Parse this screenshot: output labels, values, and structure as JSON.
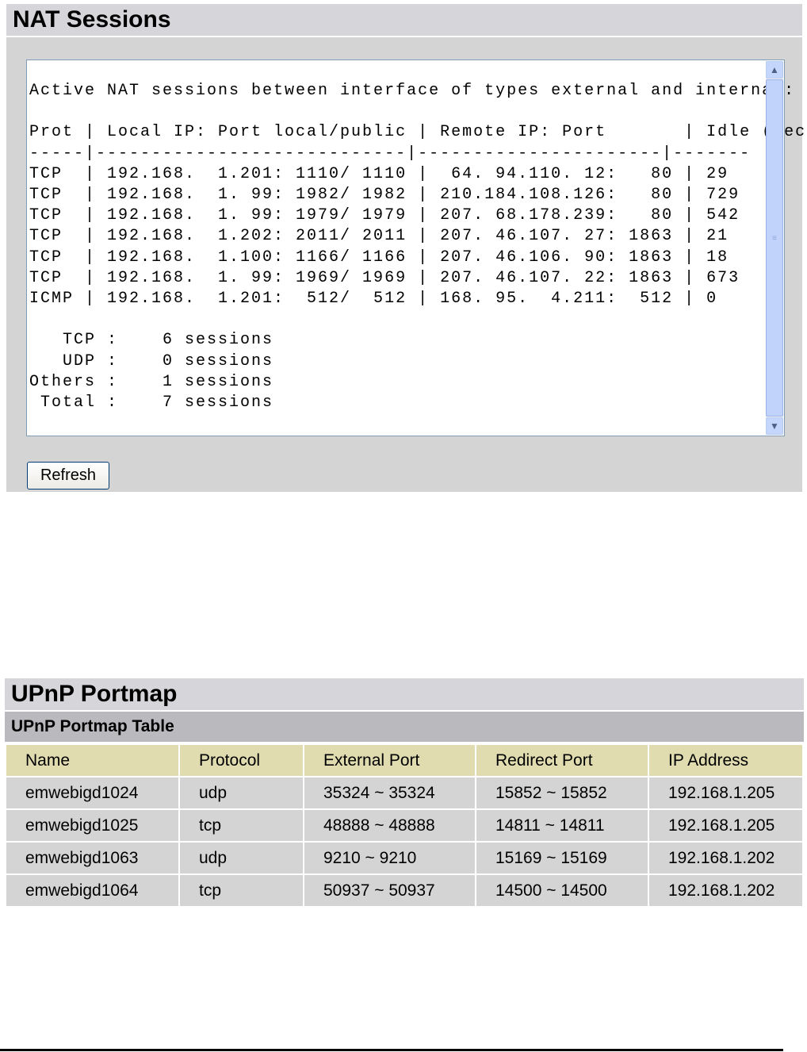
{
  "nat": {
    "title": "NAT Sessions",
    "output": "Active NAT sessions between interface of types external and internal:\n\nProt | Local IP: Port local/public | Remote IP: Port       | Idle (sec.)\n-----|----------------------------|----------------------|-------\nTCP  | 192.168.  1.201: 1110/ 1110 |  64. 94.110. 12:   80 | 29\nTCP  | 192.168.  1. 99: 1982/ 1982 | 210.184.108.126:   80 | 729\nTCP  | 192.168.  1. 99: 1979/ 1979 | 207. 68.178.239:   80 | 542\nTCP  | 192.168.  1.202: 2011/ 2011 | 207. 46.107. 27: 1863 | 21\nTCP  | 192.168.  1.100: 1166/ 1166 | 207. 46.106. 90: 1863 | 18\nTCP  | 192.168.  1. 99: 1969/ 1969 | 207. 46.107. 22: 1863 | 673\nICMP | 192.168.  1.201:  512/  512 | 168. 95.  4.211:  512 | 0\n\n   TCP :    6 sessions\n   UDP :    0 sessions\nOthers :    1 sessions\n Total :    7 sessions",
    "refresh_label": "Refresh"
  },
  "upnp": {
    "title": "UPnP Portmap",
    "subtitle": "UPnP Portmap Table",
    "columns": [
      "Name",
      "Protocol",
      "External Port",
      "Redirect Port",
      "IP Address"
    ],
    "rows": [
      [
        "emwebigd1024",
        "udp",
        "35324 ~ 35324",
        "15852 ~ 15852",
        "192.168.1.205"
      ],
      [
        "emwebigd1025",
        "tcp",
        "48888 ~ 48888",
        "14811 ~ 14811",
        "192.168.1.205"
      ],
      [
        "emwebigd1063",
        "udp",
        "9210 ~ 9210",
        "15169 ~ 15169",
        "192.168.1.202"
      ],
      [
        "emwebigd1064",
        "tcp",
        "50937 ~ 50937",
        "14500 ~ 14500",
        "192.168.1.202"
      ]
    ]
  }
}
